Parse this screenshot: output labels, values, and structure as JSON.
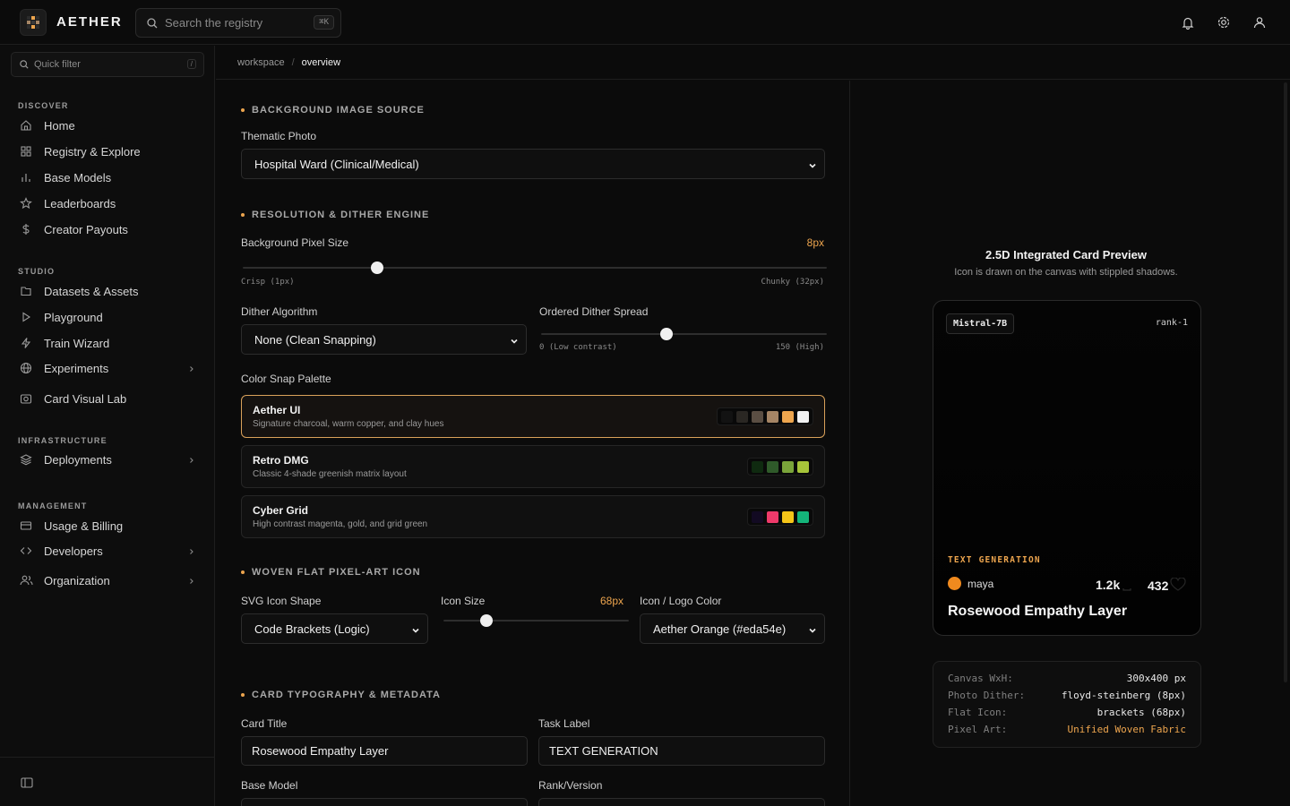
{
  "app": {
    "brand": "AETHER"
  },
  "search": {
    "placeholder": "Search the registry",
    "shortcut": "⌘K"
  },
  "sidebar": {
    "quick_filter_placeholder": "Quick filter",
    "quick_filter_shortcut": "/",
    "sections": {
      "discover": "DISCOVER",
      "studio": "STUDIO",
      "infrastructure": "INFRASTRUCTURE",
      "management": "MANAGEMENT"
    },
    "items": {
      "home": "Home",
      "registry": "Registry & Explore",
      "base_models": "Base Models",
      "leaderboards": "Leaderboards",
      "creator_payouts": "Creator Payouts",
      "datasets": "Datasets & Assets",
      "playground": "Playground",
      "train_wizard": "Train Wizard",
      "experiments": "Experiments",
      "card_visual_lab": "Card Visual Lab",
      "deployments": "Deployments",
      "usage_billing": "Usage & Billing",
      "developers": "Developers",
      "organization": "Organization"
    }
  },
  "breadcrumb": {
    "root": "workspace",
    "current": "overview"
  },
  "form": {
    "bg_section": "BACKGROUND IMAGE SOURCE",
    "thematic_photo_label": "Thematic Photo",
    "thematic_photo_value": "Hospital Ward (Clinical/Medical)",
    "res_section": "RESOLUTION & DITHER ENGINE",
    "pixel_size_label": "Background Pixel Size",
    "pixel_size_value": "8px",
    "pixel_size_fraction": 0.23,
    "pixel_size_min_hint": "Crisp (1px)",
    "pixel_size_max_hint": "Chunky (32px)",
    "dither_algo_label": "Dither Algorithm",
    "dither_algo_value": "None (Clean Snapping)",
    "dither_spread_label": "Ordered Dither Spread",
    "dither_spread_fraction": 0.44,
    "dither_spread_min_hint": "0 (Low contrast)",
    "dither_spread_max_hint": "150 (High)",
    "palette_label": "Color Snap Palette",
    "palettes": [
      {
        "name": "Aether UI",
        "desc": "Signature charcoal, warm copper, and clay hues",
        "colors": [
          "#121212",
          "#2a2723",
          "#5a4e43",
          "#a58565",
          "#eda54e",
          "#f2f2f2"
        ]
      },
      {
        "name": "Retro DMG",
        "desc": "Classic 4-shade greenish matrix layout",
        "colors": [
          "#0f2a10",
          "#2f5a2a",
          "#7aa43a",
          "#a6c43a"
        ]
      },
      {
        "name": "Cyber Grid",
        "desc": "High contrast magenta, gold, and grid green",
        "colors": [
          "#120a22",
          "#ee3a6a",
          "#f5c518",
          "#14b57a"
        ]
      }
    ],
    "icon_section": "WOVEN FLAT PIXEL-ART ICON",
    "icon_shape_label": "SVG Icon Shape",
    "icon_shape_value": "Code Brackets (Logic)",
    "icon_size_label": "Icon Size",
    "icon_size_value": "68px",
    "icon_size_fraction": 0.23,
    "icon_color_label": "Icon / Logo Color",
    "icon_color_value": "Aether Orange (#eda54e)",
    "typo_section": "CARD TYPOGRAPHY & METADATA",
    "card_title_label": "Card Title",
    "card_title_value": "Rosewood Empathy Layer",
    "task_label_label": "Task Label",
    "task_label_value": "TEXT GENERATION",
    "base_model_label": "Base Model",
    "rank_label": "Rank/Version"
  },
  "preview": {
    "title": "2.5D Integrated Card Preview",
    "subtitle": "Icon is drawn on the canvas with stippled shadows.",
    "card": {
      "tag": "Mistral-7B",
      "rank": "rank-1",
      "task": "TEXT GENERATION",
      "author": "maya",
      "downloads": "1.2k",
      "likes": "432",
      "title": "Rosewood Empathy Layer"
    },
    "meta": [
      {
        "key": "Canvas WxH:",
        "value": "300x400 px"
      },
      {
        "key": "Photo Dither:",
        "value": "floyd-steinberg (8px)"
      },
      {
        "key": "Flat Icon:",
        "value": "brackets (68px)"
      },
      {
        "key": "Pixel Art:",
        "value": "Unified Woven Fabric"
      }
    ]
  },
  "colors": {
    "accent": "#eda54e",
    "background": "#0b0b0b"
  }
}
